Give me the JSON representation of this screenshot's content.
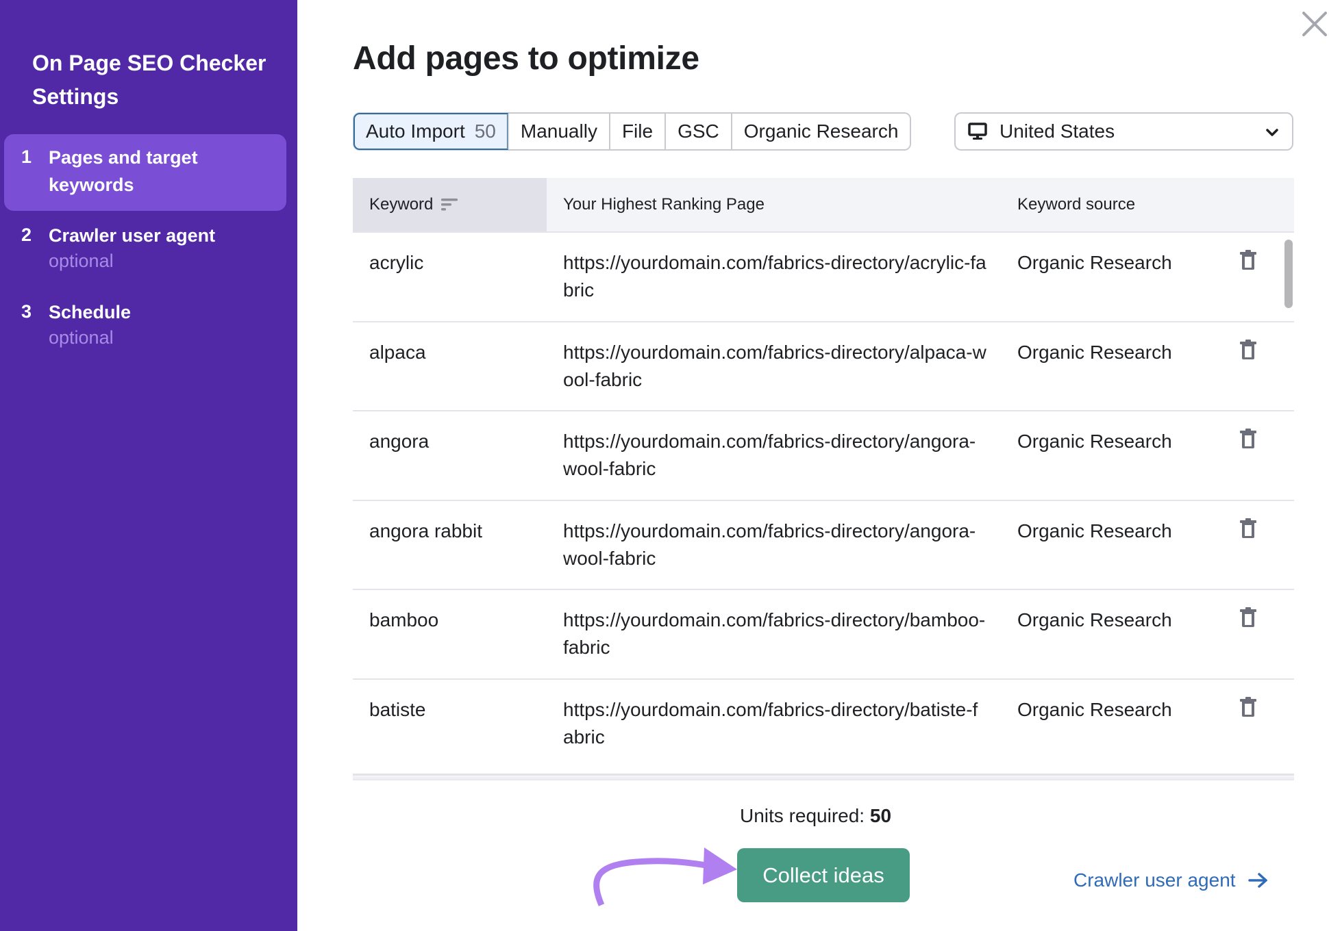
{
  "sidebar": {
    "title": "On Page SEO Checker Settings",
    "steps": [
      {
        "number": "1",
        "label": "Pages and target keywords",
        "sub": "",
        "active": true
      },
      {
        "number": "2",
        "label": "Crawler user agent",
        "sub": "optional",
        "active": false
      },
      {
        "number": "3",
        "label": "Schedule",
        "sub": "optional",
        "active": false
      }
    ]
  },
  "header": {
    "title": "Add pages to optimize"
  },
  "tabs": [
    {
      "label": "Auto Import",
      "count": "50",
      "active": true
    },
    {
      "label": "Manually",
      "count": "",
      "active": false
    },
    {
      "label": "File",
      "count": "",
      "active": false
    },
    {
      "label": "GSC",
      "count": "",
      "active": false
    },
    {
      "label": "Organic Research",
      "count": "",
      "active": false
    }
  ],
  "location": {
    "icon": "desktop-icon",
    "selected": "United States"
  },
  "table": {
    "columns": [
      "Keyword",
      "Your Highest Ranking Page",
      "Keyword source"
    ],
    "rows": [
      {
        "keyword": "acrylic",
        "page": "https://yourdomain.com/fabrics-directory/acrylic-fabric",
        "source": "Organic Research"
      },
      {
        "keyword": "alpaca",
        "page": "https://yourdomain.com/fabrics-directory/alpaca-wool-fabric",
        "source": "Organic Research"
      },
      {
        "keyword": "angora",
        "page": "https://yourdomain.com/fabrics-directory/angora-wool-fabric",
        "source": "Organic Research"
      },
      {
        "keyword": "angora rabbit",
        "page": "https://yourdomain.com/fabrics-directory/angora-wool-fabric",
        "source": "Organic Research"
      },
      {
        "keyword": "bamboo",
        "page": "https://yourdomain.com/fabrics-directory/bamboo-fabric",
        "source": "Organic Research"
      },
      {
        "keyword": "batiste",
        "page": "https://yourdomain.com/fabrics-directory/batiste-fabric",
        "source": "Organic Research"
      }
    ]
  },
  "footer": {
    "units_label": "Units required:",
    "units_value": "50",
    "collect_button": "Collect ideas",
    "next_link": "Crawler user agent"
  },
  "colors": {
    "sidebar_bg": "#5129a6",
    "sidebar_active": "#7a4fd6",
    "primary_button": "#499c84",
    "link": "#2f6bb6",
    "annotation_arrow": "#b07ff0"
  }
}
